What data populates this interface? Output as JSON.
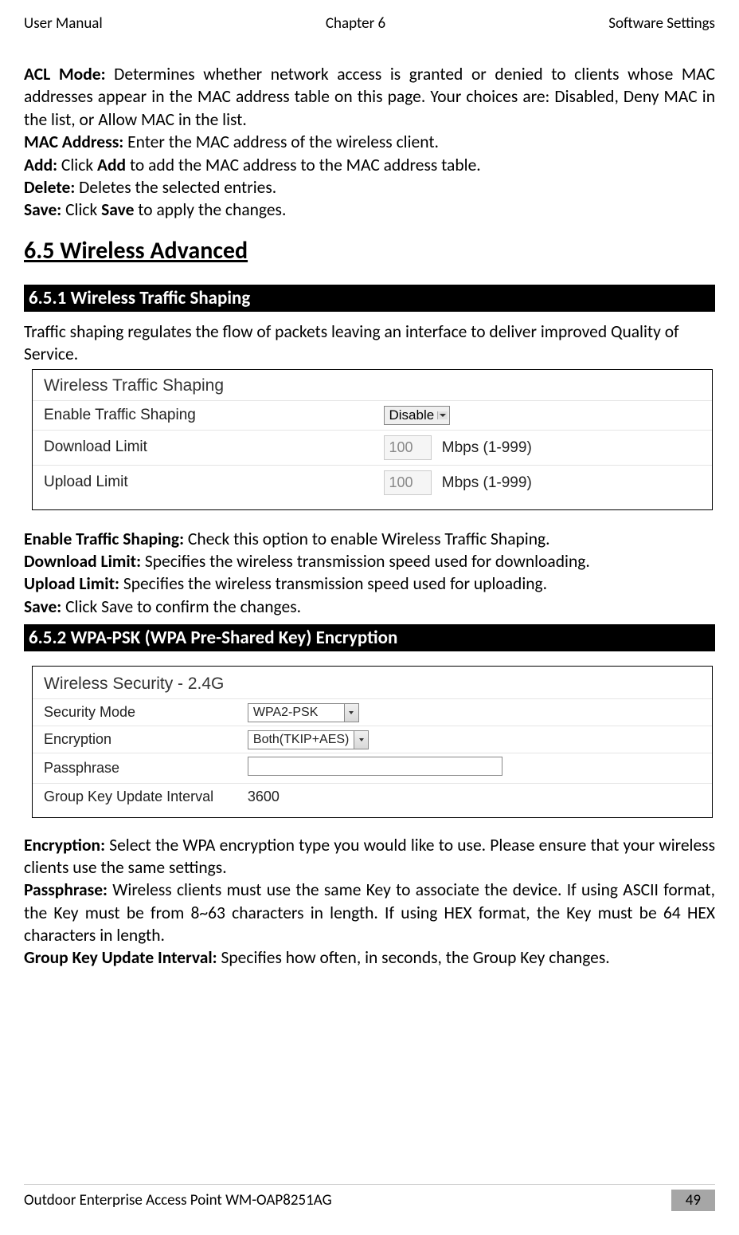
{
  "header": {
    "left": "User Manual",
    "center": "Chapter 6",
    "right": "Software Settings"
  },
  "para1": {
    "acl_label": "ACL Mode:",
    "acl_text": " Determines whether network access is granted or denied to clients whose MAC addresses appear in the MAC address table on this page. Your choices are: Disabled, Deny MAC in the list, or Allow MAC in the list.",
    "mac_label": "MAC Address:",
    "mac_text": " Enter the MAC address of the wireless client.",
    "add_label": "Add:",
    "add_text_pre": " Click ",
    "add_bold": "Add",
    "add_text_post": " to add the MAC address to the MAC address table.",
    "del_label": "Delete:",
    "del_text": " Deletes the selected entries.",
    "save_label": "Save:",
    "save_text_pre": " Click ",
    "save_bold": "Save",
    "save_text_post": " to apply the changes."
  },
  "section_title": "6.5 Wireless Advanced",
  "sub1": "6.5.1 Wireless Traffic Shaping",
  "sub1_intro": "Traffic shaping regulates the flow of packets leaving an interface to deliver improved Quality of Service.",
  "ts_panel": {
    "title": "Wireless Traffic Shaping",
    "rows": [
      {
        "label": "Enable Traffic Shaping",
        "value": "Disable",
        "type": "select"
      },
      {
        "label": "Download Limit",
        "value": "100",
        "unit": "Mbps (1-999)",
        "type": "number"
      },
      {
        "label": "Upload Limit",
        "value": "100",
        "unit": "Mbps (1-999)",
        "type": "number"
      }
    ]
  },
  "ts_desc": {
    "enable_label": "Enable Traffic Shaping:",
    "enable_text": " Check this option to enable Wireless Traffic Shaping.",
    "dl_label": "Download Limit:",
    "dl_text": " Specifies the wireless transmission speed used for downloading.",
    "ul_label": "Upload Limit:",
    "ul_text": " Specifies the wireless transmission speed used for uploading.",
    "save_label": "Save:",
    "save_text": " Click Save to confirm the changes."
  },
  "sub2": "6.5.2 WPA-PSK (WPA Pre-Shared Key) Encryption",
  "sec_panel": {
    "title": "Wireless Security - 2.4G",
    "rows": [
      {
        "label": "Security Mode",
        "value": "WPA2-PSK",
        "type": "dropdown"
      },
      {
        "label": "Encryption",
        "value": "Both(TKIP+AES)",
        "type": "dropdown-short"
      },
      {
        "label": "Passphrase",
        "value": "",
        "type": "text"
      },
      {
        "label": "Group Key Update Interval",
        "value": "3600",
        "type": "plain"
      }
    ]
  },
  "sec_desc": {
    "enc_label": "Encryption:",
    "enc_text": " Select the WPA encryption type you would like to use. Please ensure that your wireless clients use the same settings.",
    "pass_label": "Passphrase:",
    "pass_text": " Wireless clients must use the same Key to associate the device. If using ASCII format, the Key must be from 8~63 characters in length. If using HEX format, the Key must be 64 HEX characters in length.",
    "gki_label": "Group Key Update Interval:",
    "gki_text": " Specifies how often, in seconds, the Group Key changes."
  },
  "footer": {
    "product": "Outdoor Enterprise Access Point WM-OAP8251AG",
    "page": "49"
  }
}
